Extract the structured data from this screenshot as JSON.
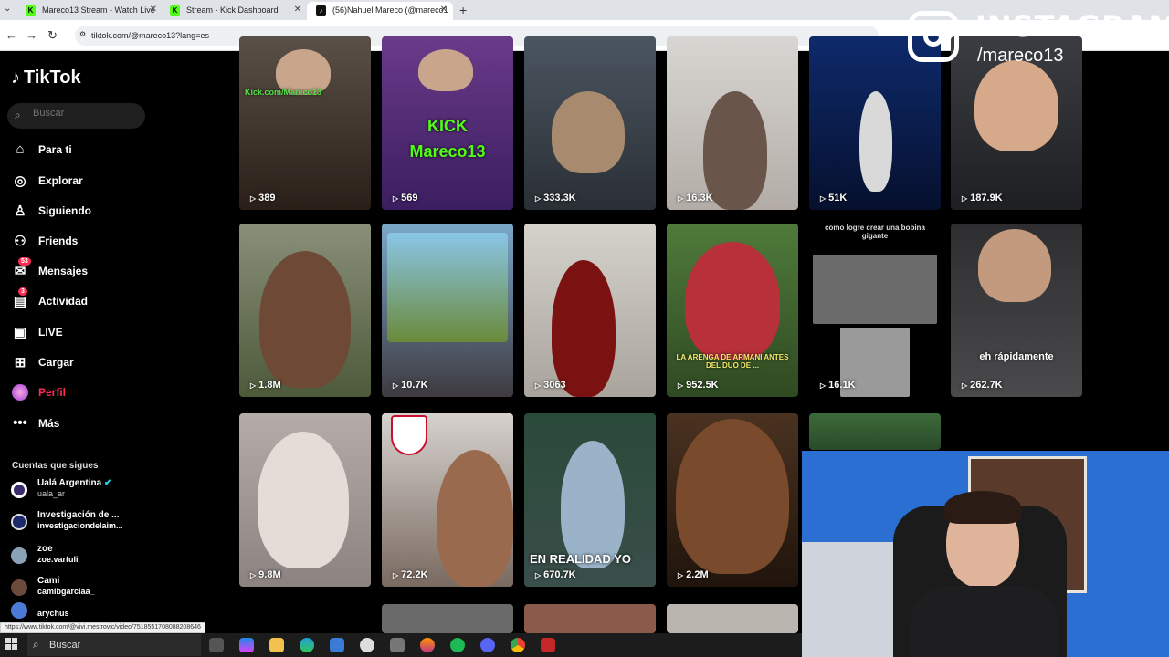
{
  "browser": {
    "tabs": [
      {
        "title": "Mareco13 Stream - Watch Live",
        "favicon": "K"
      },
      {
        "title": "Stream - Kick Dashboard",
        "favicon": "K"
      },
      {
        "title": "(56)Nahuel Mareco (@mareco1",
        "favicon": "tiktok-icon"
      }
    ],
    "new_tab": "+",
    "url": "tiktok.com/@mareco13?lang=es"
  },
  "sidebar": {
    "logo": "TikTok",
    "search_placeholder": "Buscar",
    "nav": [
      {
        "label": "Para ti",
        "icon": "home-icon"
      },
      {
        "label": "Explorar",
        "icon": "compass-icon"
      },
      {
        "label": "Siguiendo",
        "icon": "user-follow-icon"
      },
      {
        "label": "Friends",
        "icon": "friends-icon"
      },
      {
        "label": "Mensajes",
        "icon": "message-icon",
        "badge": "53"
      },
      {
        "label": "Actividad",
        "icon": "activity-icon",
        "badge": "3"
      },
      {
        "label": "LIVE",
        "icon": "live-icon"
      },
      {
        "label": "Cargar",
        "icon": "upload-icon"
      },
      {
        "label": "Perfil",
        "icon": "avatar-icon"
      },
      {
        "label": "Más",
        "icon": "more-icon"
      }
    ],
    "following_title": "Cuentas que sigues",
    "following": [
      {
        "name": "Ualá Argentina",
        "handle": "uala_ar",
        "verified": true
      },
      {
        "name": "Investigación de ...",
        "handle": "investigaciondelaim..."
      },
      {
        "name": "zoe",
        "handle": "zoe.vartuli"
      },
      {
        "name": "Cami",
        "handle": "camibgarciaa_"
      },
      {
        "name": "",
        "handle": "arychus"
      }
    ]
  },
  "videos": [
    {
      "views": "389",
      "caption": "Kick.com/Mareco13"
    },
    {
      "views": "569",
      "caption": "KICK Mareco13"
    },
    {
      "views": "333.3K",
      "caption": ""
    },
    {
      "views": "16.3K",
      "caption": ""
    },
    {
      "views": "51K",
      "caption": ""
    },
    {
      "views": "187.9K",
      "caption": ""
    },
    {
      "views": "1.8M",
      "caption": ""
    },
    {
      "views": "10.7K",
      "caption": ""
    },
    {
      "views": "3063",
      "caption": ""
    },
    {
      "views": "952.5K",
      "caption": "LA ARENGA DE ARMANI ANTES DEL DUO DE ..."
    },
    {
      "views": "16.1K",
      "caption": "como logre crear una bobina gigante"
    },
    {
      "views": "262.7K",
      "caption": "eh rápidamente"
    },
    {
      "views": "9.8M",
      "caption": ""
    },
    {
      "views": "72.2K",
      "caption": ""
    },
    {
      "views": "670.7K",
      "caption": "EN REALIDAD YO"
    },
    {
      "views": "2.2M",
      "caption": ""
    },
    {
      "views": "",
      "caption": ""
    }
  ],
  "overlay": {
    "brand": "INSTAGRAM",
    "handle": "/mareco13"
  },
  "status_url": "https://www.tiktok.com/@vivi.mestrovic/video/7518551708088208646",
  "taskbar": {
    "search": "Buscar"
  }
}
